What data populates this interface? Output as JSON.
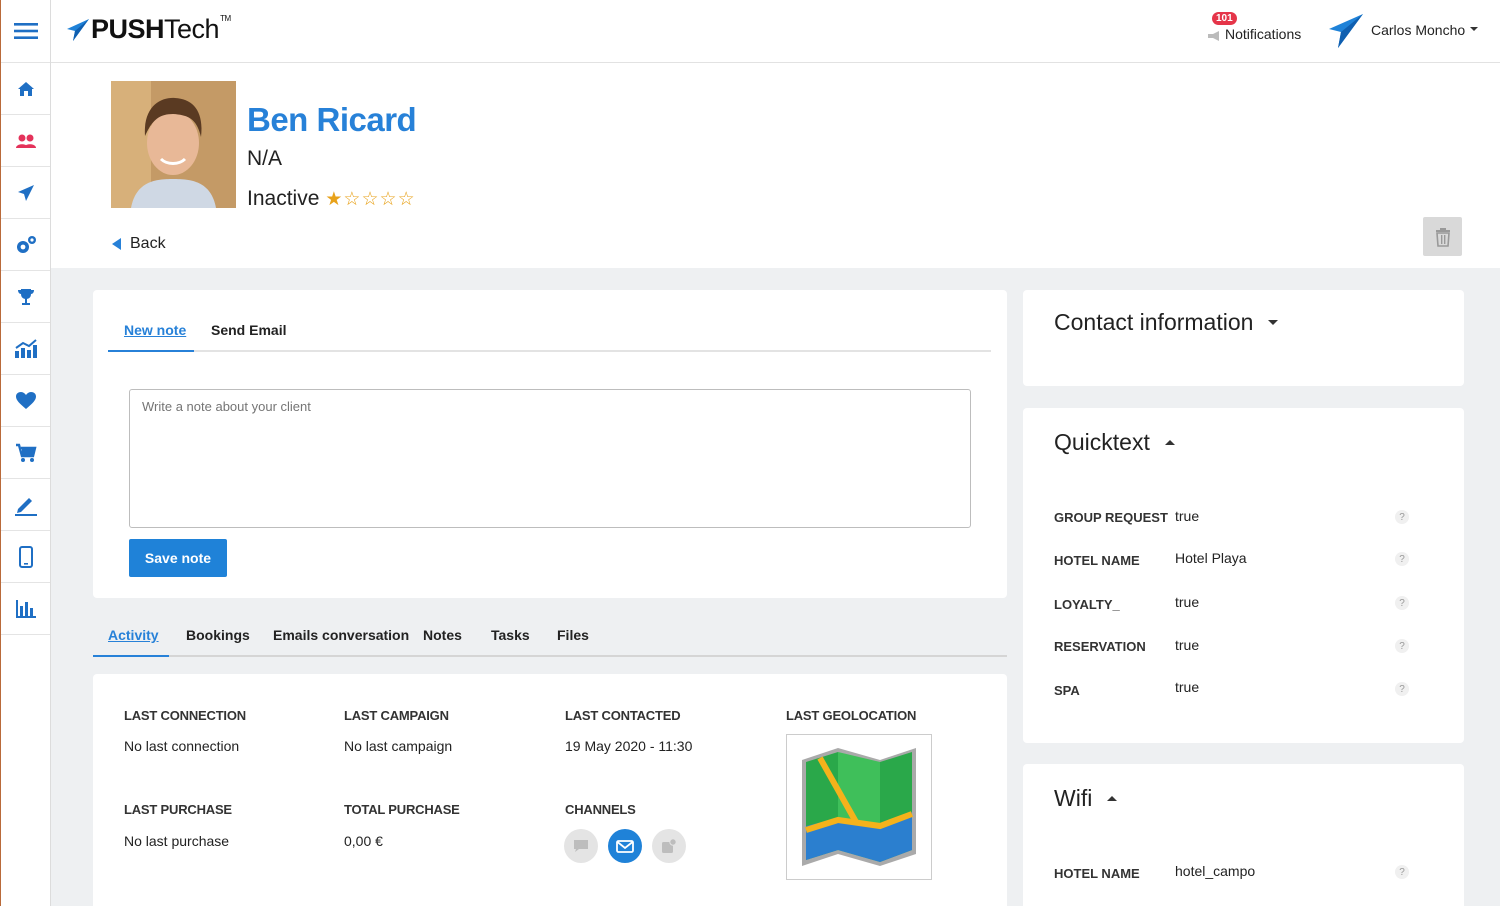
{
  "app": {
    "logo_bold": "PUSH",
    "logo_light": "Tech",
    "logo_tm": "TM"
  },
  "sidebar": {
    "items": [
      {
        "icon": "menu-icon"
      },
      {
        "icon": "home-icon"
      },
      {
        "icon": "users-icon"
      },
      {
        "icon": "send-icon"
      },
      {
        "icon": "settings-icon"
      },
      {
        "icon": "trophy-icon"
      },
      {
        "icon": "analytics-icon"
      },
      {
        "icon": "heart-icon"
      },
      {
        "icon": "cart-icon"
      },
      {
        "icon": "edit-icon"
      },
      {
        "icon": "mobile-icon"
      },
      {
        "icon": "bar-chart-icon"
      }
    ]
  },
  "topbar": {
    "notifications_count": "101",
    "notifications_label": "Notifications",
    "user_name": "Carlos Moncho"
  },
  "profile": {
    "name": "Ben Ricard",
    "subtitle": "N/A",
    "status": "Inactive",
    "rating": 1,
    "rating_max": 5,
    "back_label": "Back"
  },
  "note": {
    "tabs": [
      "New note",
      "Send Email"
    ],
    "placeholder": "Write a note about your client",
    "save_label": "Save note"
  },
  "activity_tabs": [
    "Activity",
    "Bookings",
    "Emails conversation",
    "Notes",
    "Tasks",
    "Files"
  ],
  "activity": {
    "last_connection_label": "LAST CONNECTION",
    "last_connection_value": "No last connection",
    "last_campaign_label": "LAST CAMPAIGN",
    "last_campaign_value": "No last campaign",
    "last_contacted_label": "LAST CONTACTED",
    "last_contacted_value": "19 May 2020 - 11:30",
    "last_geolocation_label": "LAST GEOLOCATION",
    "last_purchase_label": "LAST PURCHASE",
    "last_purchase_value": "No last purchase",
    "total_purchase_label": "TOTAL PURCHASE",
    "total_purchase_value": "0,00 €",
    "channels_label": "CHANNELS"
  },
  "contact": {
    "title": "Contact information"
  },
  "quicktext": {
    "title": "Quicktext",
    "rows": [
      {
        "label": "GROUP REQUEST",
        "value": "true"
      },
      {
        "label": "HOTEL NAME",
        "value": "Hotel Playa"
      },
      {
        "label": "LOYALTY_",
        "value": "true"
      },
      {
        "label": "RESERVATION",
        "value": "true"
      },
      {
        "label": "SPA",
        "value": "true"
      }
    ],
    "help": "?"
  },
  "wifi": {
    "title": "Wifi",
    "rows": [
      {
        "label": "HOTEL NAME",
        "value": "hotel_campo"
      }
    ],
    "help": "?"
  },
  "colors": {
    "accent": "#2781d8",
    "star": "#e8a21a",
    "badge": "#e53549"
  }
}
